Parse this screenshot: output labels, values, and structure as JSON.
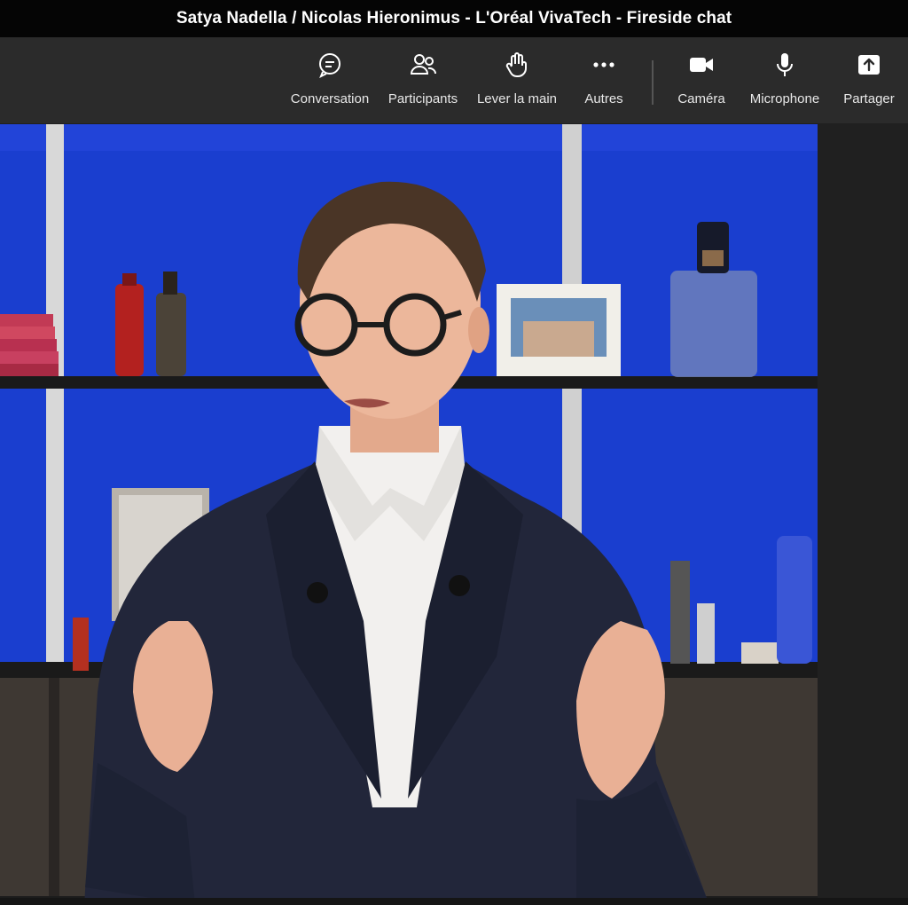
{
  "window": {
    "title": "Satya Nadella / Nicolas Hieronimus - L'Oréal VivaTech - Fireside chat"
  },
  "toolbar": {
    "buttons": [
      {
        "label": "Conversation",
        "icon": "chat-bubble-icon"
      },
      {
        "label": "Participants",
        "icon": "people-icon"
      },
      {
        "label": "Lever la main",
        "icon": "raise-hand-icon"
      },
      {
        "label": "Autres",
        "icon": "more-dots-icon"
      },
      {
        "label": "Caméra",
        "icon": "video-camera-icon"
      },
      {
        "label": "Microphone",
        "icon": "microphone-icon"
      },
      {
        "label": "Partager",
        "icon": "share-tray-icon"
      }
    ]
  },
  "colors": {
    "titlebar_bg": "#050505",
    "toolbar_bg": "#2b2b2b",
    "backdrop_blue": "#1b3fd0",
    "side_panel": "#202020"
  }
}
